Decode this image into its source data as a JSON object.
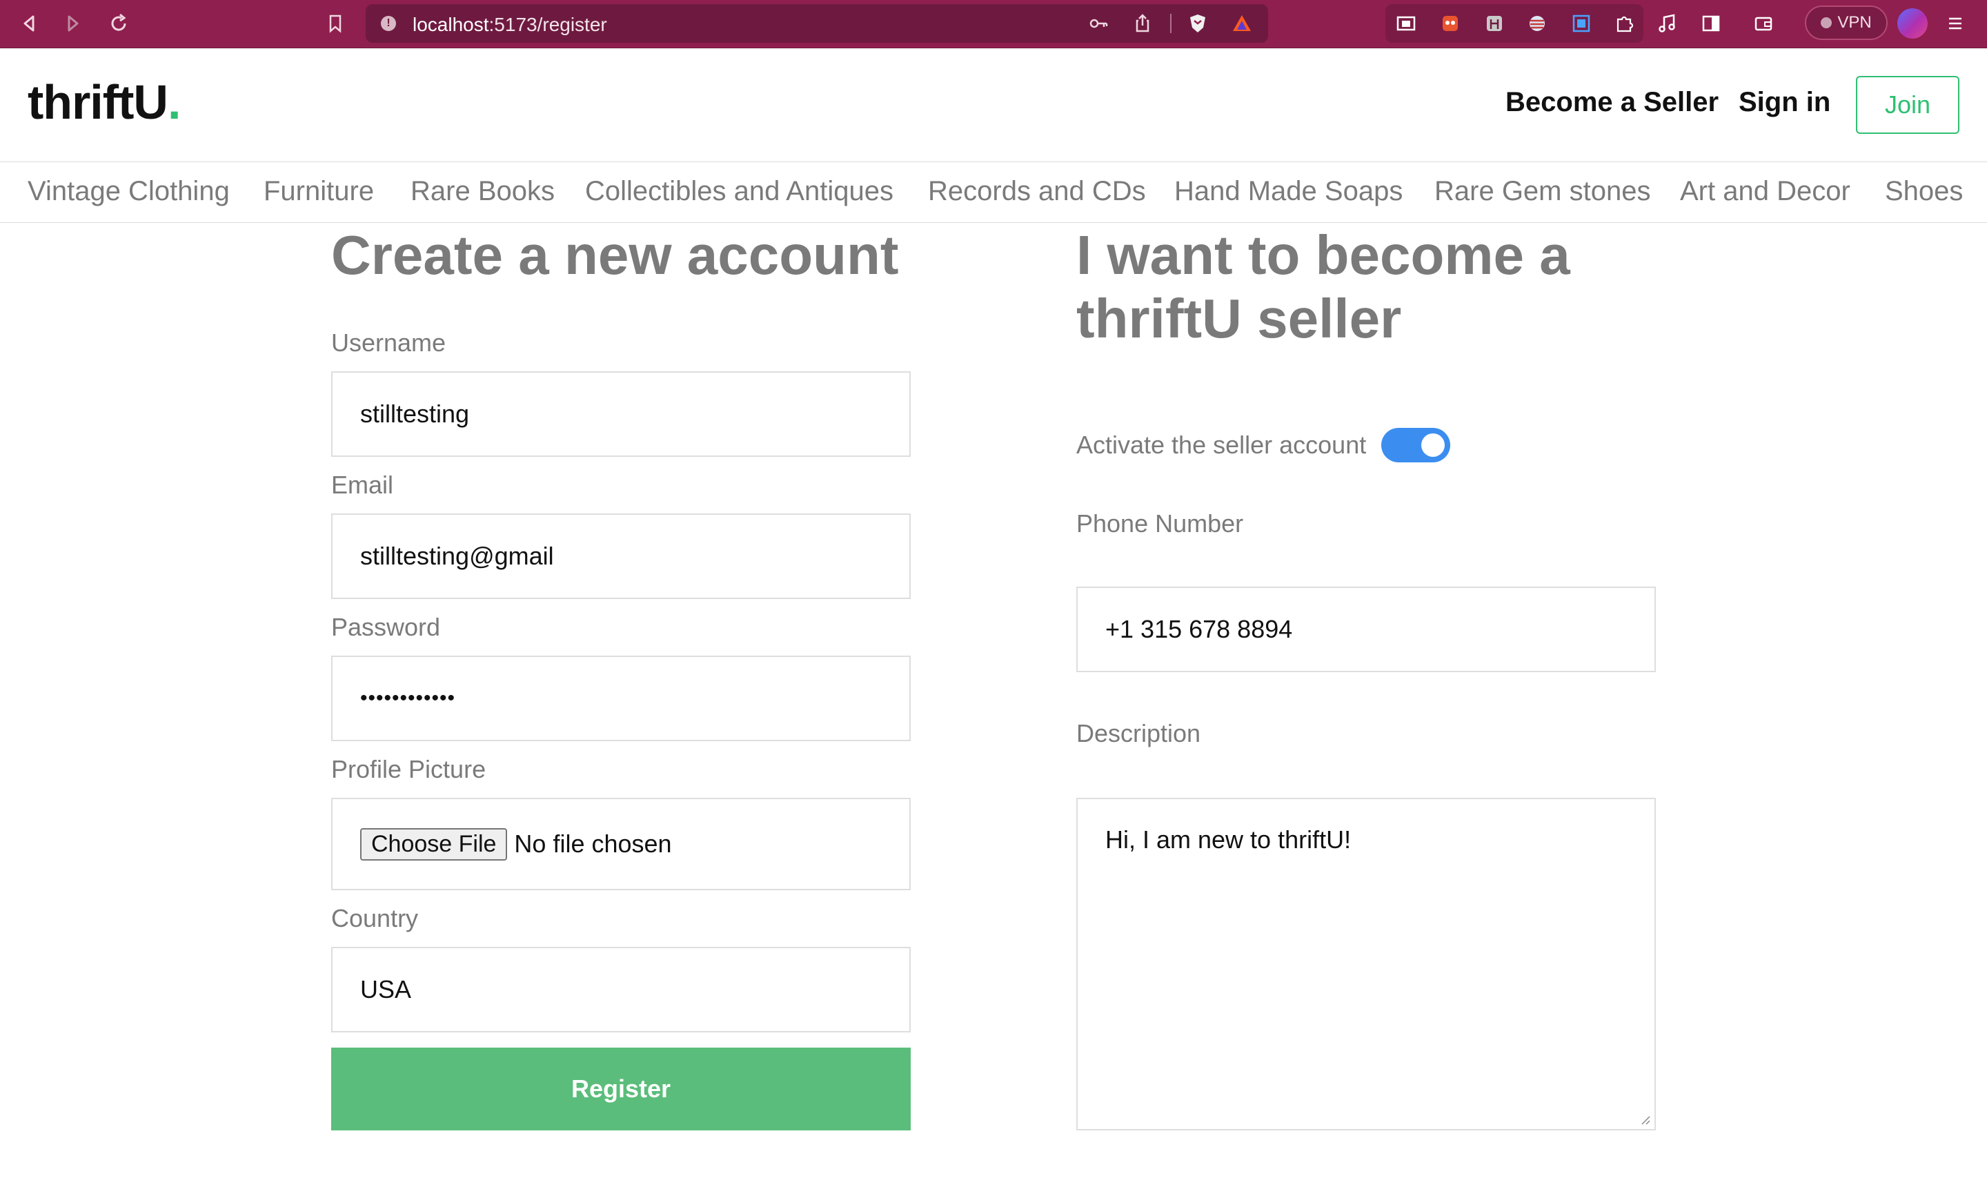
{
  "browser": {
    "url_host": "localhost",
    "url_path": ":5173/register",
    "vpn_label": "VPN"
  },
  "header": {
    "logo_text": "thriftU",
    "logo_dot": ".",
    "become_seller": "Become a Seller",
    "sign_in": "Sign in",
    "join": "Join"
  },
  "categories": [
    "Vintage Clothing",
    "Furniture",
    "Rare Books",
    "Collectibles and Antiques",
    "Records and CDs",
    "Hand Made Soaps",
    "Rare Gem stones",
    "Art and Decor",
    "Shoes"
  ],
  "account_form": {
    "title": "Create a new account",
    "username_label": "Username",
    "username_value": "stilltesting",
    "email_label": "Email",
    "email_value": "stilltesting@gmail",
    "password_label": "Password",
    "password_value": "••••••••••••",
    "profile_label": "Profile Picture",
    "choose_file": "Choose File",
    "no_file": "No file chosen",
    "country_label": "Country",
    "country_value": "USA",
    "register": "Register"
  },
  "seller_form": {
    "title_line1": "I want to become a",
    "title_line2": "thriftU seller",
    "activate_label": "Activate the seller account",
    "activate_on": true,
    "phone_label": "Phone Number",
    "phone_value": "+1 315 678 8894",
    "description_label": "Description",
    "description_value": "Hi, I am new to thriftU!"
  },
  "colors": {
    "browser_chrome": "#8f1f4e",
    "brand_green": "#2fbf71",
    "register_green": "#5bbd7b",
    "toggle_blue": "#3b8ef0"
  }
}
